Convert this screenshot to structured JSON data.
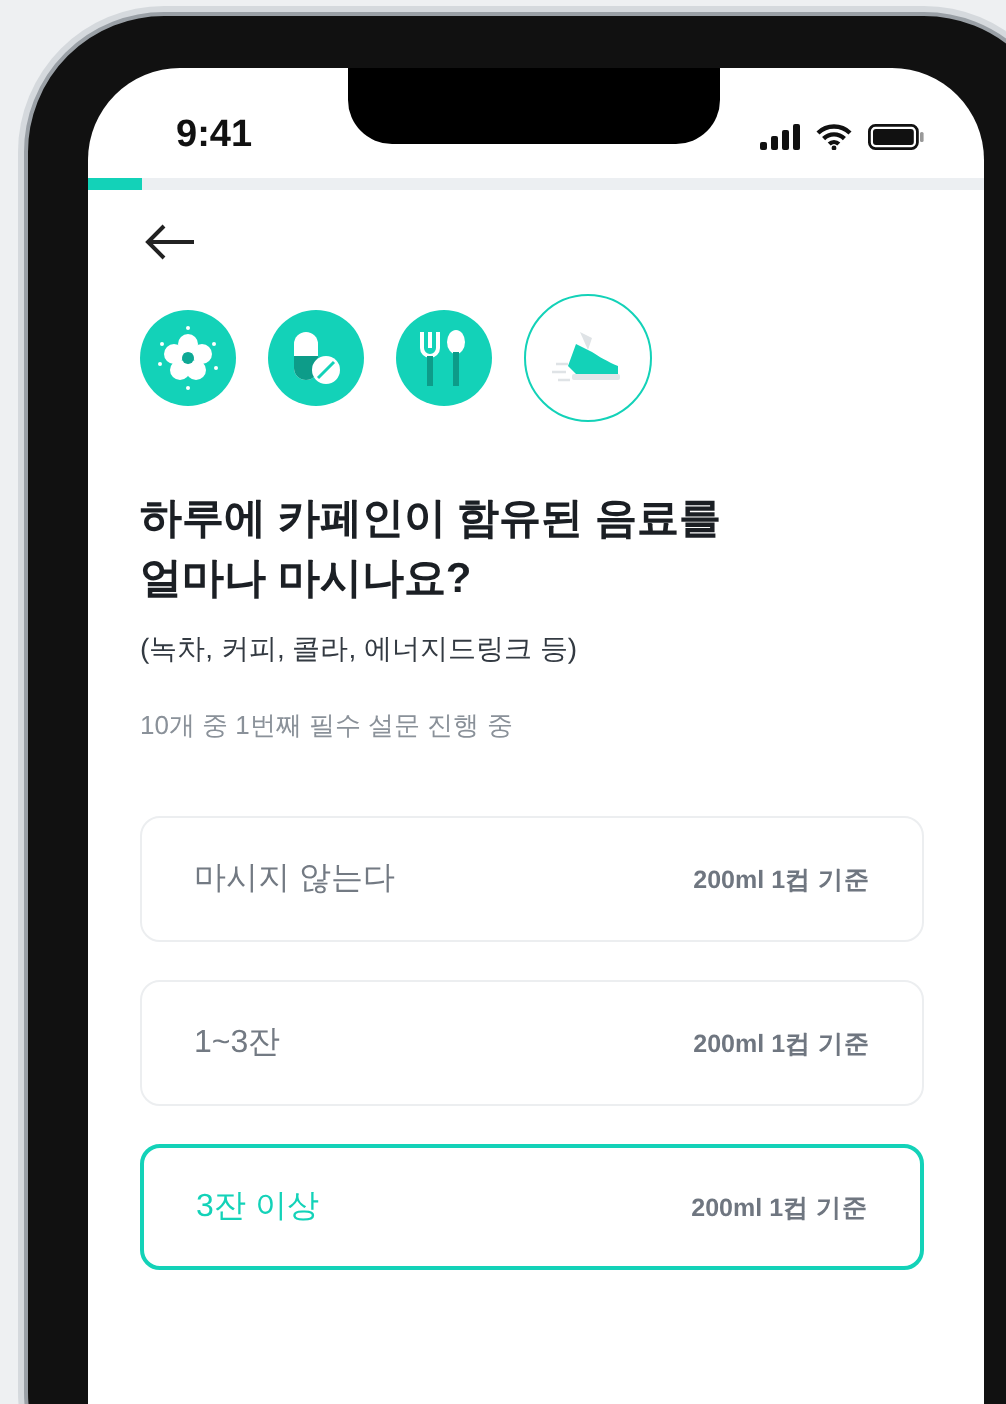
{
  "status_bar": {
    "time": "9:41"
  },
  "progress": {
    "level": 0.06
  },
  "steps": [
    {
      "kind": "flower",
      "current": false
    },
    {
      "kind": "pill",
      "current": false
    },
    {
      "kind": "cutlery",
      "current": false
    },
    {
      "kind": "shoe",
      "current": true
    }
  ],
  "question": {
    "title": "하루에 카페인이 함유된 음료를\n얼마나 마시나요?",
    "subtitle": "(녹차, 커피, 콜라, 에너지드링크 등)",
    "counter": "10개 중 1번째 필수 설문 진행 중"
  },
  "options": [
    {
      "label": "마시지 않는다",
      "note": "200ml 1컵 기준",
      "selected": false
    },
    {
      "label": "1~3잔",
      "note": "200ml 1컵 기준",
      "selected": false
    },
    {
      "label": "3잔 이상",
      "note": "200ml 1컵 기준",
      "selected": true
    }
  ]
}
